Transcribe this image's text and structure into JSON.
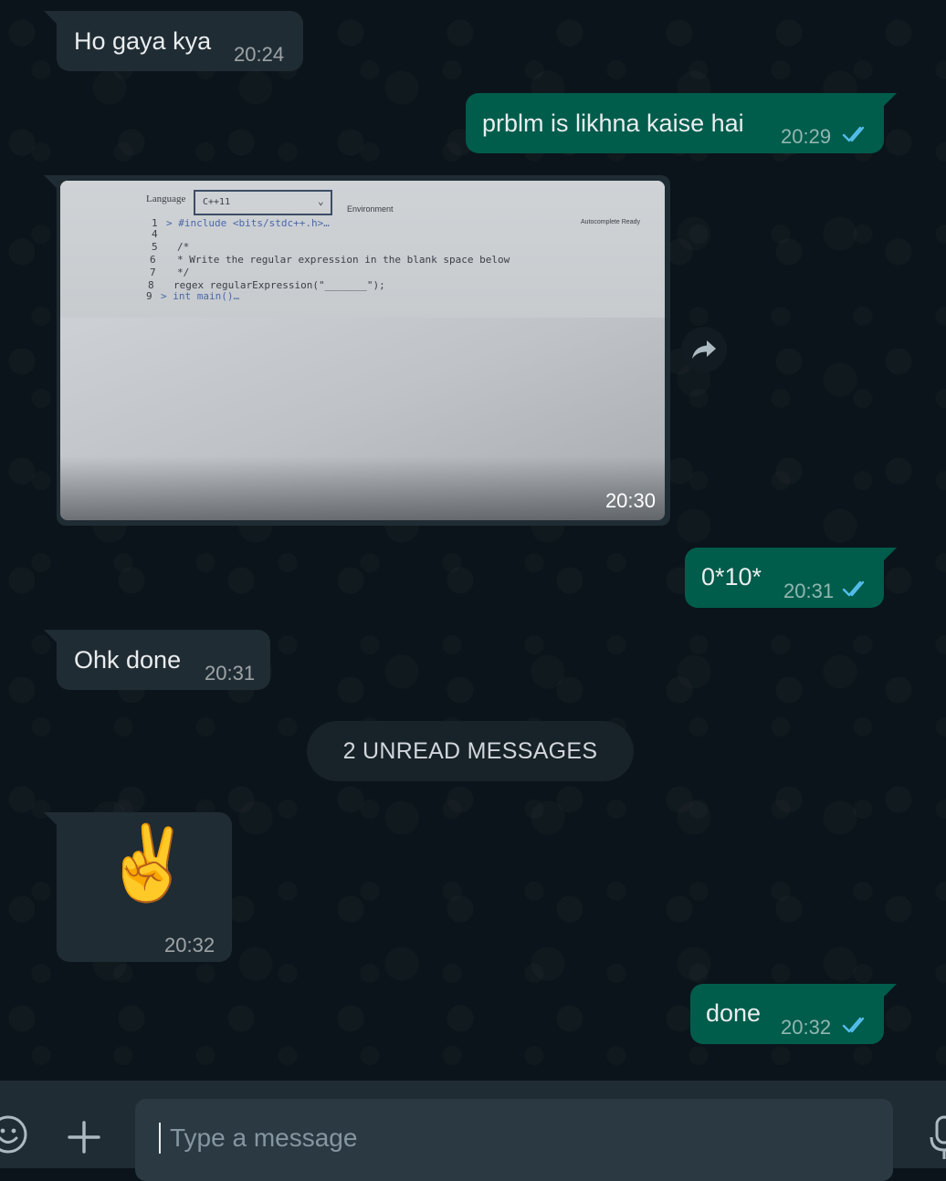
{
  "messages": [
    {
      "direction": "incoming",
      "type": "text",
      "text": "Ho gaya kya",
      "time": "20:24"
    },
    {
      "direction": "outgoing",
      "type": "text",
      "text": "prblm is likhna kaise hai",
      "time": "20:29",
      "status": "read"
    },
    {
      "direction": "incoming",
      "type": "image",
      "time": "20:30",
      "image_content": {
        "language_label": "Language",
        "language_value": "C++11",
        "environment": "Environment",
        "autocomplete": "Autocomplete Ready",
        "code_lines": [
          {
            "n": "1",
            "code": "> #include <bits/stdc++.h>…"
          },
          {
            "n": "4",
            "code": ""
          },
          {
            "n": "5",
            "code": "/*"
          },
          {
            "n": "6",
            "code": " * Write the regular expression in the blank space below"
          },
          {
            "n": "7",
            "code": " */"
          },
          {
            "n": "8",
            "code": "regex regularExpression(\"_______\");"
          },
          {
            "n": "9",
            "code": "> int main()…"
          }
        ]
      }
    },
    {
      "direction": "outgoing",
      "type": "text",
      "text": "0*10*",
      "time": "20:31",
      "status": "read"
    },
    {
      "direction": "incoming",
      "type": "text",
      "text": "Ohk done",
      "time": "20:31"
    },
    {
      "direction": "incoming",
      "type": "emoji",
      "text": "✌️",
      "time": "20:32"
    },
    {
      "direction": "outgoing",
      "type": "text",
      "text": "done",
      "time": "20:32",
      "status": "read"
    }
  ],
  "unread_divider": "2 UNREAD MESSAGES",
  "composer": {
    "placeholder": "Type a message",
    "icons": [
      "emoji-icon",
      "plus-icon",
      "mic-icon"
    ]
  },
  "icons": {
    "forward": "forward-icon",
    "read_status": "double-check-icon"
  },
  "colors": {
    "background": "#0b141a",
    "incoming_bubble": "#202c33",
    "outgoing_bubble": "#005c4b",
    "read_ticks": "#53bdeb",
    "composer": "#202c33",
    "input": "#2a3942"
  }
}
